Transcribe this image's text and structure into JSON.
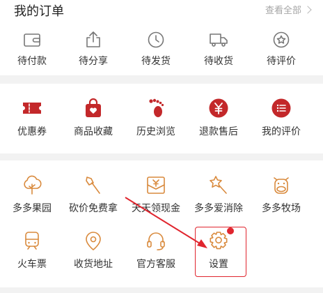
{
  "orders": {
    "title": "我的订单",
    "view_all": "查看全部",
    "items": [
      {
        "label": "待付款",
        "icon": "wallet-icon"
      },
      {
        "label": "待分享",
        "icon": "share-icon"
      },
      {
        "label": "待发货",
        "icon": "clock-icon"
      },
      {
        "label": "待收货",
        "icon": "truck-icon"
      },
      {
        "label": "待评价",
        "icon": "star-badge-icon"
      }
    ]
  },
  "tools": {
    "items": [
      {
        "label": "优惠券",
        "icon": "coupon-icon"
      },
      {
        "label": "商品收藏",
        "icon": "favorite-bag-icon"
      },
      {
        "label": "历史浏览",
        "icon": "footprint-icon"
      },
      {
        "label": "退款售后",
        "icon": "refund-yen-icon"
      },
      {
        "label": "我的评价",
        "icon": "comment-list-icon"
      }
    ]
  },
  "more": {
    "items": [
      {
        "label": "多多果园",
        "icon": "tree-icon"
      },
      {
        "label": "砍价免费拿",
        "icon": "axe-icon"
      },
      {
        "label": "天天领现金",
        "icon": "cash-envelope-icon"
      },
      {
        "label": "多多爱消除",
        "icon": "star-wand-icon"
      },
      {
        "label": "多多牧场",
        "icon": "cow-icon"
      },
      {
        "label": "火车票",
        "icon": "train-icon"
      },
      {
        "label": "收货地址",
        "icon": "location-icon"
      },
      {
        "label": "官方客服",
        "icon": "headset-icon"
      },
      {
        "label": "设置",
        "icon": "settings-gear-icon"
      }
    ]
  },
  "colors": {
    "accent_red": "#e0252e",
    "icon_orange": "#d98a3d",
    "icon_gray": "#777777",
    "text": "#333333"
  }
}
